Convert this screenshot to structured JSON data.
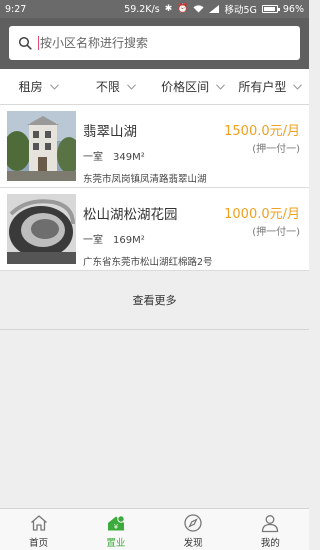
{
  "status_bar": {
    "time": "9:27",
    "network_speed": "59.2K/s",
    "carrier": "移动5G",
    "battery": "96%",
    "battery_level": 0.96,
    "icons": [
      "bluetooth-icon",
      "alarm-icon",
      "wifi-icon",
      "signal-icon",
      "battery-icon"
    ]
  },
  "search": {
    "placeholder": "按小区名称进行搜索"
  },
  "filters": [
    {
      "label": "租房"
    },
    {
      "label": "不限"
    },
    {
      "label": "价格区间"
    },
    {
      "label": "所有户型"
    }
  ],
  "listings": [
    {
      "name": "翡翠山湖",
      "rooms": "一室",
      "area": "349M²",
      "address": "东莞市凤岗镇凤清路翡翠山湖",
      "price": "1500.0元/月",
      "payment": "(押一付一)"
    },
    {
      "name": "松山湖松湖花园",
      "rooms": "一室",
      "area": "169M²",
      "address": "广东省东莞市松山湖红棉路2号",
      "price": "1000.0元/月",
      "payment": "(押一付一)"
    }
  ],
  "load_more": "查看更多",
  "tabbar": [
    {
      "label": "首页",
      "icon": "home-icon",
      "active": false
    },
    {
      "label": "置业",
      "icon": "property-icon",
      "active": true
    },
    {
      "label": "发现",
      "icon": "compass-icon",
      "active": false
    },
    {
      "label": "我的",
      "icon": "user-icon",
      "active": false
    }
  ],
  "colors": {
    "accent": "#3caa3c",
    "price": "#f0a11f",
    "header": "#5f5f5f"
  }
}
